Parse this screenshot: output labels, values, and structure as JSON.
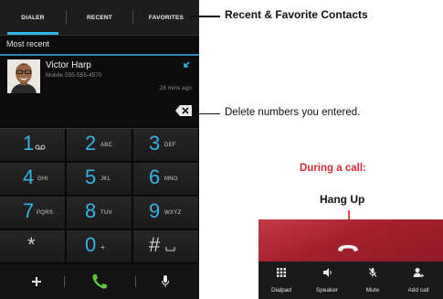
{
  "tabs": [
    {
      "label": "DIALER",
      "active": true
    },
    {
      "label": "RECENT",
      "active": false
    },
    {
      "label": "FAVORITES",
      "active": false
    }
  ],
  "section_header": "Most recent",
  "contact": {
    "name": "Victor Harp",
    "number": "Mobile 555-555-4570",
    "time": "28 mins ago"
  },
  "keys": [
    {
      "digit": "1",
      "letters": "",
      "icon": "voicemail-icon"
    },
    {
      "digit": "2",
      "letters": "ABC"
    },
    {
      "digit": "3",
      "letters": "DEF"
    },
    {
      "digit": "4",
      "letters": "GHI"
    },
    {
      "digit": "5",
      "letters": "JKL"
    },
    {
      "digit": "6",
      "letters": "MNO"
    },
    {
      "digit": "7",
      "letters": "PQRS"
    },
    {
      "digit": "8",
      "letters": "TUV"
    },
    {
      "digit": "9",
      "letters": "WXYZ"
    },
    {
      "digit": "*",
      "letters": ""
    },
    {
      "digit": "0",
      "letters": "+"
    },
    {
      "digit": "#",
      "letters": "",
      "icon": "space-icon"
    }
  ],
  "bottom_bar": {
    "left_icon": "plus-icon",
    "center_icon": "phone-icon",
    "right_icon": "microphone-icon"
  },
  "annotations": {
    "contacts": "Recent & Favorite Contacts",
    "delete": "Delete numbers you entered.",
    "during_call": "During a call:",
    "hang_up": "Hang Up"
  },
  "call_controls": [
    {
      "label": "Dialpad",
      "icon": "dialpad-icon"
    },
    {
      "label": "Speaker",
      "icon": "speaker-icon"
    },
    {
      "label": "Mute",
      "icon": "mute-microphone-icon"
    },
    {
      "label": "Add call",
      "icon": "add-call-icon"
    }
  ],
  "colors": {
    "accent": "#33b5e5",
    "hangup_red": "#d52b3a",
    "call_green": "#5ec53f"
  }
}
